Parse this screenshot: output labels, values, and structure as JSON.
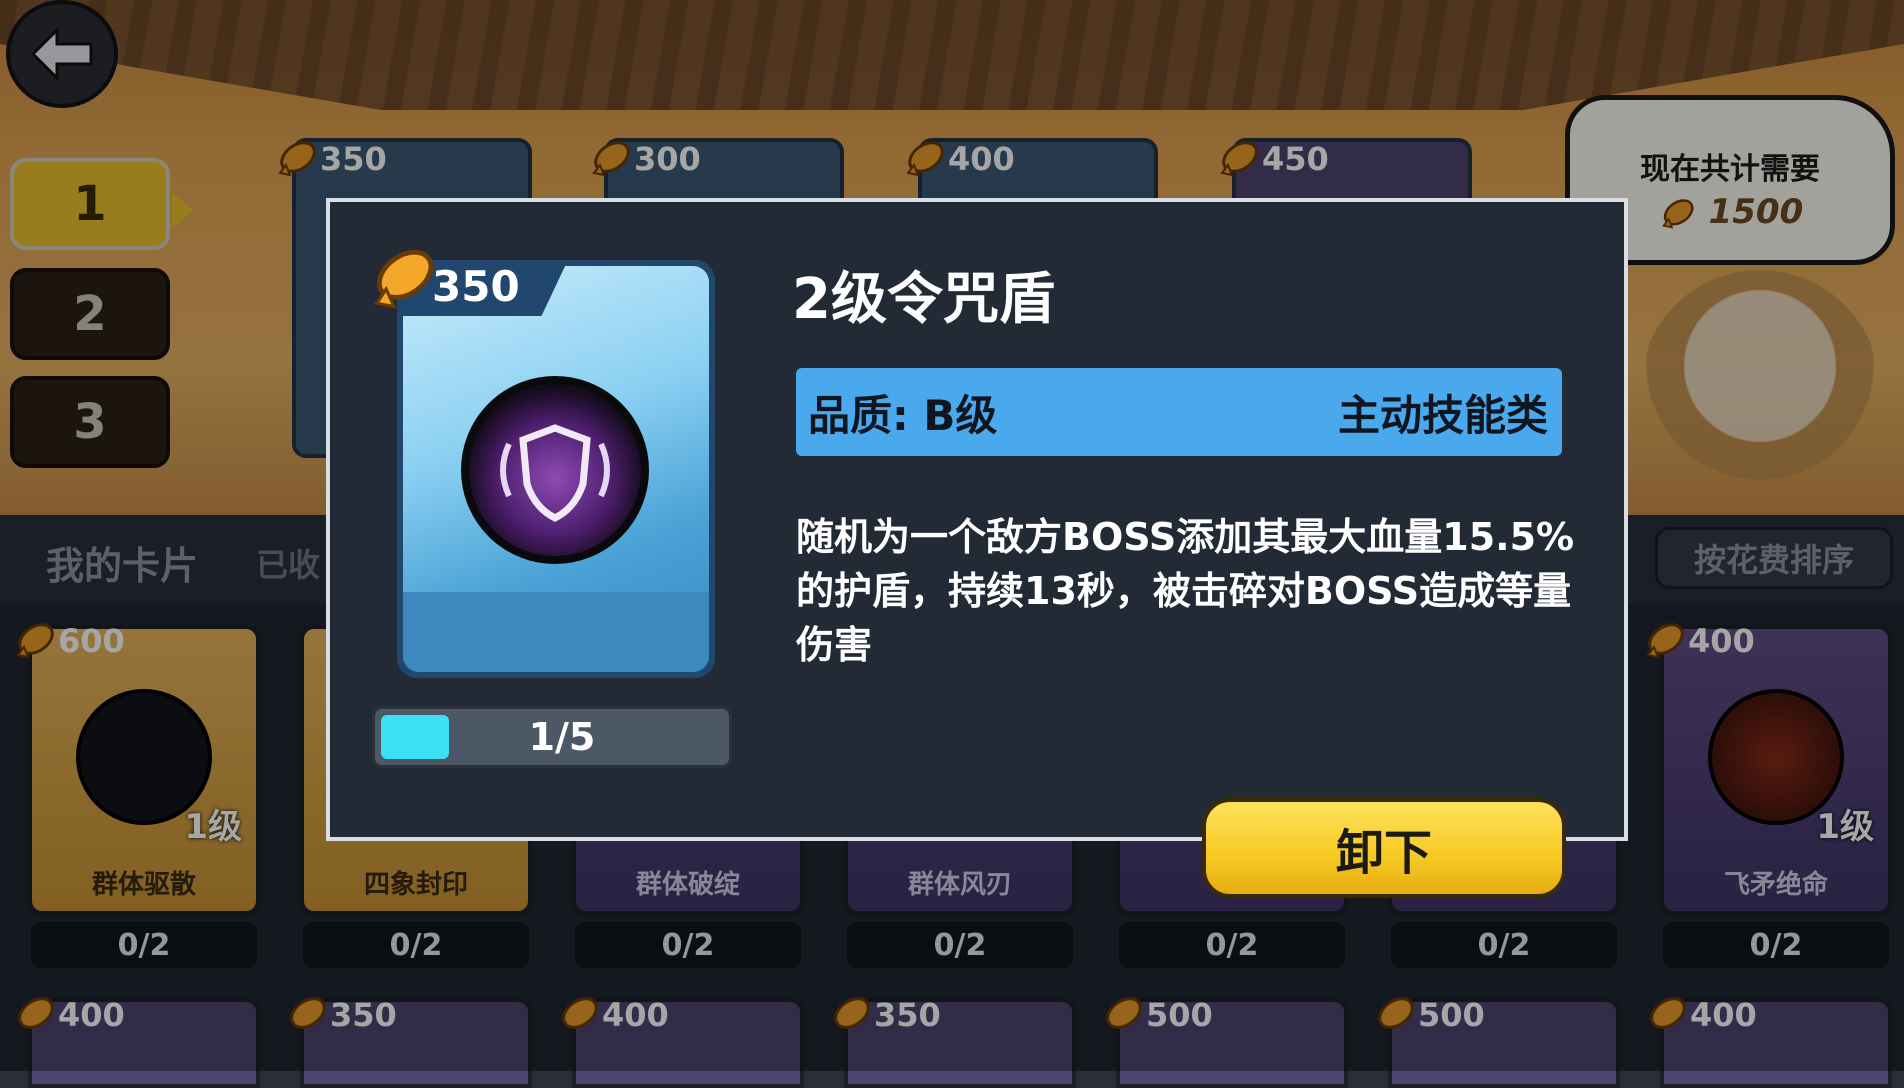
{
  "sidebar": {
    "tabs": [
      "1",
      "2",
      "3"
    ],
    "active_tab": "1"
  },
  "top_row": {
    "costs": [
      "350",
      "300",
      "400",
      "450"
    ],
    "summary": {
      "title": "现在共计需要",
      "total": "1500"
    }
  },
  "deck": {
    "label": "我的卡片",
    "collected_label": "已收",
    "sort_button": "按花费排序",
    "cards": [
      {
        "cost": "600",
        "name": "群体驱散",
        "level": "1级",
        "count": "0/2"
      },
      {
        "cost": "",
        "name": "四象封印",
        "level": "",
        "count": "0/2"
      },
      {
        "cost": "",
        "name": "群体破绽",
        "level": "",
        "count": "0/2"
      },
      {
        "cost": "",
        "name": "群体风刃",
        "level": "",
        "count": "0/2"
      },
      {
        "cost": "",
        "name": "",
        "level": "",
        "count": "0/2"
      },
      {
        "cost": "",
        "name": "",
        "level": "",
        "count": "0/2"
      },
      {
        "cost": "400",
        "name": "飞矛绝命",
        "level": "1级",
        "count": "0/2"
      }
    ],
    "next_row_costs": [
      "400",
      "350",
      "400",
      "350",
      "500",
      "500",
      "400"
    ]
  },
  "modal": {
    "cost": "350",
    "title": "2级令咒盾",
    "quality": "品质: B级",
    "category": "主动技能类",
    "description": "随机为一个敌方BOSS添加其最大血量15.5%的护盾，持续13秒，被击碎对BOSS造成等量伤害",
    "progress_text": "1/5",
    "progress_value": 0.2,
    "unequip_button": "卸下"
  },
  "colors": {
    "accent_yellow": "#f6c923",
    "quality_bar": "#4aa8ec",
    "progress_fill": "#3ddff2"
  }
}
